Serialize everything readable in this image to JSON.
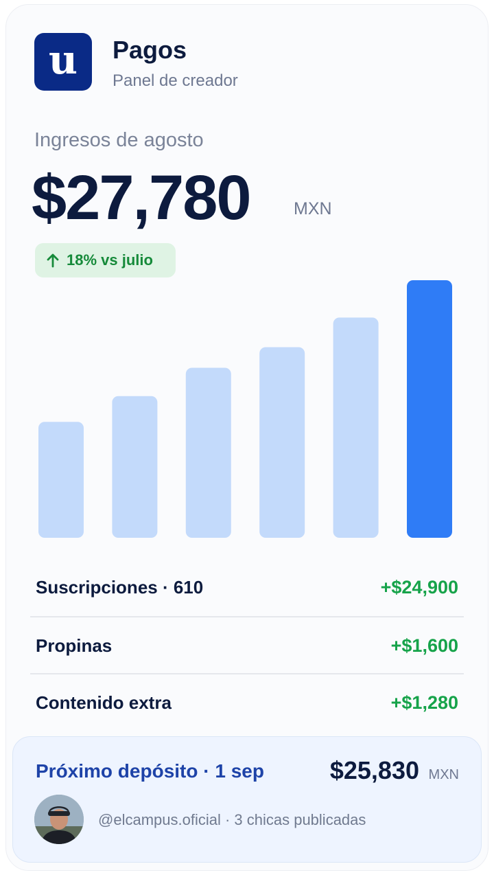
{
  "header": {
    "logo_glyph": "u",
    "title": "Pagos",
    "subtitle": "Panel de creador"
  },
  "summary": {
    "period_label": "Ingresos de agosto",
    "amount": "$27,780",
    "currency": "MXN",
    "change": "18% vs julio"
  },
  "chart_data": {
    "type": "bar",
    "title": "",
    "categories": [],
    "values": [
      0.45,
      0.55,
      0.66,
      0.74,
      0.855,
      1.0
    ],
    "ylim": [
      0,
      1
    ],
    "highlighted_index": 5,
    "colors": {
      "bar": "#c3dafb",
      "highlight": "#2f7cf6"
    },
    "grid": false,
    "legend": "none"
  },
  "breakdown": [
    {
      "label": "Suscripciones · 610",
      "value": "+$24,900"
    },
    {
      "label": "Propinas",
      "value": "+$1,600"
    },
    {
      "label": "Contenido extra",
      "value": "+$1,280"
    }
  ],
  "deposit": {
    "label": "Próximo depósito · 1 sep",
    "amount": "$25,830",
    "currency": "MXN",
    "account": "@elcampus.oficial · 3 chicas publicadas"
  },
  "colors": {
    "brand": "#0a2a86",
    "positive": "#16a34a",
    "accent": "#2f7cf6",
    "deposit_label": "#1e43a8"
  }
}
